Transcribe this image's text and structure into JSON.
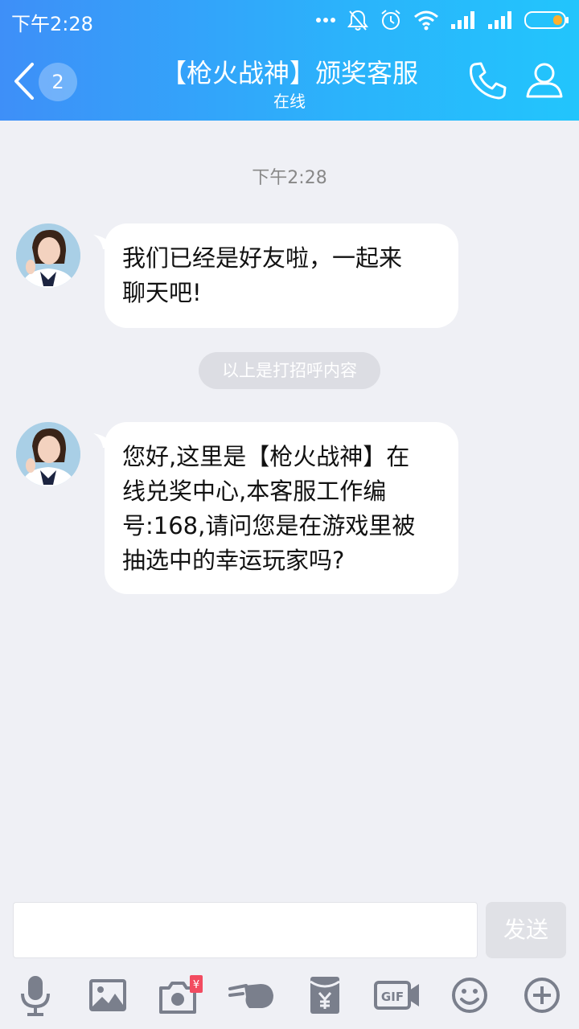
{
  "status_bar": {
    "time": "下午2:28"
  },
  "header": {
    "unread_count": "2",
    "title": "【枪火战神】颁奖客服",
    "subtitle": "在线"
  },
  "chat": {
    "timestamp": "下午2:28",
    "messages": [
      {
        "text_lines": [
          "我们已经是好友啦，一起来",
          "聊天吧!"
        ]
      },
      {
        "text_lines": [
          "您好,这里是【枪火战神】在",
          "线兑奖中心,本客服工作编",
          "号:168,请问您是在游戏里被",
          "抽选中的幸运玩家吗?"
        ]
      }
    ],
    "greeting_notice": "以上是打招呼内容"
  },
  "composer": {
    "input_value": "",
    "send_label": "发送",
    "red_packet_badge": "¥"
  },
  "toolbar_icons": [
    "microphone-icon",
    "image-icon",
    "camera-icon",
    "poke-icon",
    "red-packet-icon",
    "gif-icon",
    "emoji-icon",
    "plus-icon"
  ],
  "colors": {
    "header_start": "#3e8ff8",
    "header_end": "#22c5fc",
    "background": "#eff0f5",
    "icon_gray": "#7a7f8c",
    "badge_red": "#f24b60"
  }
}
